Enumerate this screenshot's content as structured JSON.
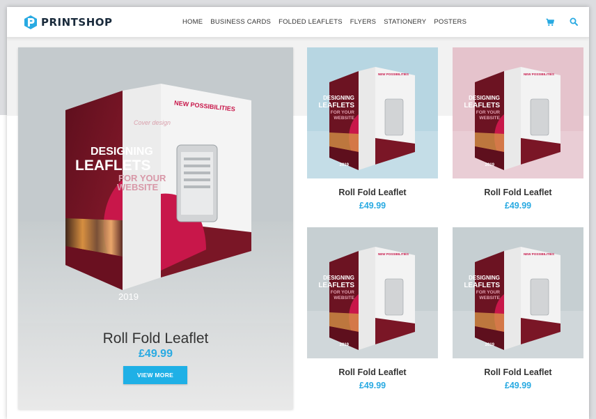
{
  "brand": {
    "name": "PRINTSHOP",
    "accent": "#29aae2"
  },
  "nav": {
    "items": [
      {
        "label": "HOME"
      },
      {
        "label": "BUSINESS CARDS"
      },
      {
        "label": "FOLDED LEAFLETS"
      },
      {
        "label": "FLYERS"
      },
      {
        "label": "STATIONERY"
      },
      {
        "label": "POSTERS"
      }
    ],
    "cart_icon": "cart-icon",
    "search_icon": "search-icon"
  },
  "featured": {
    "title": "Roll Fold Leaflet",
    "price": "£49.99",
    "button_label": "VIEW MORE",
    "mockup": {
      "heading": "DESIGNING",
      "heading2": "LEAFLETS",
      "sub1": "FOR YOUR",
      "sub2": "WEBSITE",
      "year": "2019",
      "cover_note": "Cover design",
      "inner_heading": "NEW POSSIBILITIES"
    }
  },
  "products": [
    {
      "title": "Roll Fold Leaflet",
      "price": "£49.99",
      "bg": "#b7d6e2"
    },
    {
      "title": "Roll Fold Leaflet",
      "price": "£49.99",
      "bg": "#e5c3cc"
    },
    {
      "title": "Roll Fold Leaflet",
      "price": "£49.99",
      "bg": "#c6cfd2"
    },
    {
      "title": "Roll Fold Leaflet",
      "price": "£49.99",
      "bg": "#c6cfd2"
    }
  ],
  "colors": {
    "leaflet_maroon": "#7a1626",
    "leaflet_crimson": "#c8174a",
    "button_blue": "#1fb0e6"
  }
}
